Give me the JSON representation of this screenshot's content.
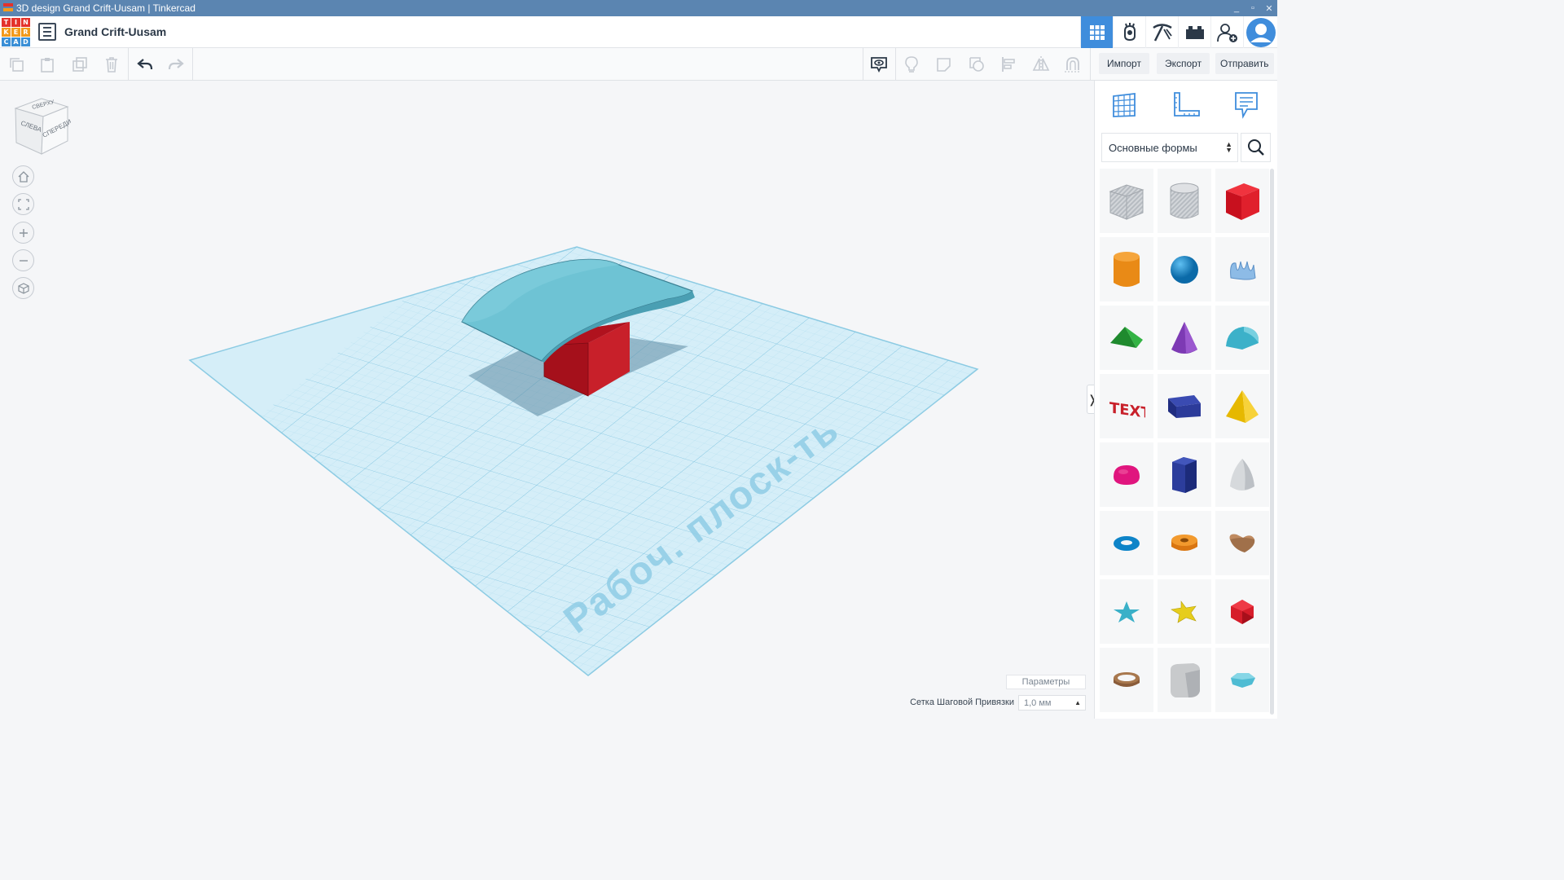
{
  "window": {
    "title": "3D design Grand Crift-Uusam | Tinkercad",
    "controls": [
      "_",
      "▫",
      "✕"
    ]
  },
  "header": {
    "logo_letters": [
      "T",
      "I",
      "N",
      "K",
      "E",
      "R",
      "C",
      "A",
      "D"
    ],
    "logo_colors": [
      "#e4322b",
      "#e4322b",
      "#e4322b",
      "#f39a1c",
      "#f39a1c",
      "#f39a1c",
      "#3a8fd6",
      "#3a8fd6",
      "#3a8fd6"
    ],
    "design_name": "Grand Crift-Uusam",
    "nav_icons": [
      "grid-view-icon",
      "gallery-hand-icon",
      "pickaxe-icon",
      "bricks-icon",
      "add-user-icon",
      "avatar-icon"
    ]
  },
  "toolbar": {
    "left_icons": [
      "copy-icon",
      "paste-icon",
      "duplicate-icon",
      "delete-icon",
      "undo-icon",
      "redo-icon"
    ],
    "right_icons": [
      "show-all-icon",
      "light-bulb-icon",
      "note-icon",
      "group-icon",
      "align-icon",
      "mirror-icon",
      "magnet-icon"
    ],
    "import_label": "Импорт",
    "export_label": "Экспорт",
    "send_label": "Отправить"
  },
  "viewcube": {
    "top": "СВЕРХУ",
    "left": "СЛЕВА",
    "front": "СПЕРЕДИ"
  },
  "workplane": {
    "label": "Рабоч. плоск-ть",
    "accent": "#6fc3e0"
  },
  "panel": {
    "tabs": [
      "grid-icon",
      "ruler-icon",
      "notes-icon"
    ],
    "shape_category": "Основные формы",
    "shapes": [
      {
        "name": "box-hole",
        "color": "#c4c8cc"
      },
      {
        "name": "cylinder-hole",
        "color": "#c4c8cc"
      },
      {
        "name": "box",
        "color": "#e0202c"
      },
      {
        "name": "cylinder",
        "color": "#e98a16"
      },
      {
        "name": "sphere",
        "color": "#1a8fd1"
      },
      {
        "name": "scribble",
        "color": "#6ea7d8"
      },
      {
        "name": "roof",
        "color": "#2aa33a"
      },
      {
        "name": "cone",
        "color": "#7d3ab4"
      },
      {
        "name": "round-roof",
        "color": "#3cb1c9"
      },
      {
        "name": "text",
        "color": "#c8202a"
      },
      {
        "name": "wedge",
        "color": "#2c3b9a"
      },
      {
        "name": "pyramid",
        "color": "#f2c418"
      },
      {
        "name": "half-sphere",
        "color": "#e0157e"
      },
      {
        "name": "polygon",
        "color": "#233694"
      },
      {
        "name": "paraboloid",
        "color": "#cfd2d6"
      },
      {
        "name": "torus",
        "color": "#0e84c8"
      },
      {
        "name": "tube",
        "color": "#e98a16"
      },
      {
        "name": "heart",
        "color": "#a0704a"
      },
      {
        "name": "star",
        "color": "#3ab0c8"
      },
      {
        "name": "star-yellow",
        "color": "#e6cd1c"
      },
      {
        "name": "icosahedron",
        "color": "#d61d2a"
      },
      {
        "name": "ring",
        "color": "#a0704a"
      },
      {
        "name": "rounded-box",
        "color": "#c8cacc"
      },
      {
        "name": "diamond",
        "color": "#4fbcd3"
      }
    ]
  },
  "footer": {
    "params_label": "Параметры",
    "snap_label": "Сетка Шаговой Привязки",
    "snap_value": "1,0 мм"
  }
}
